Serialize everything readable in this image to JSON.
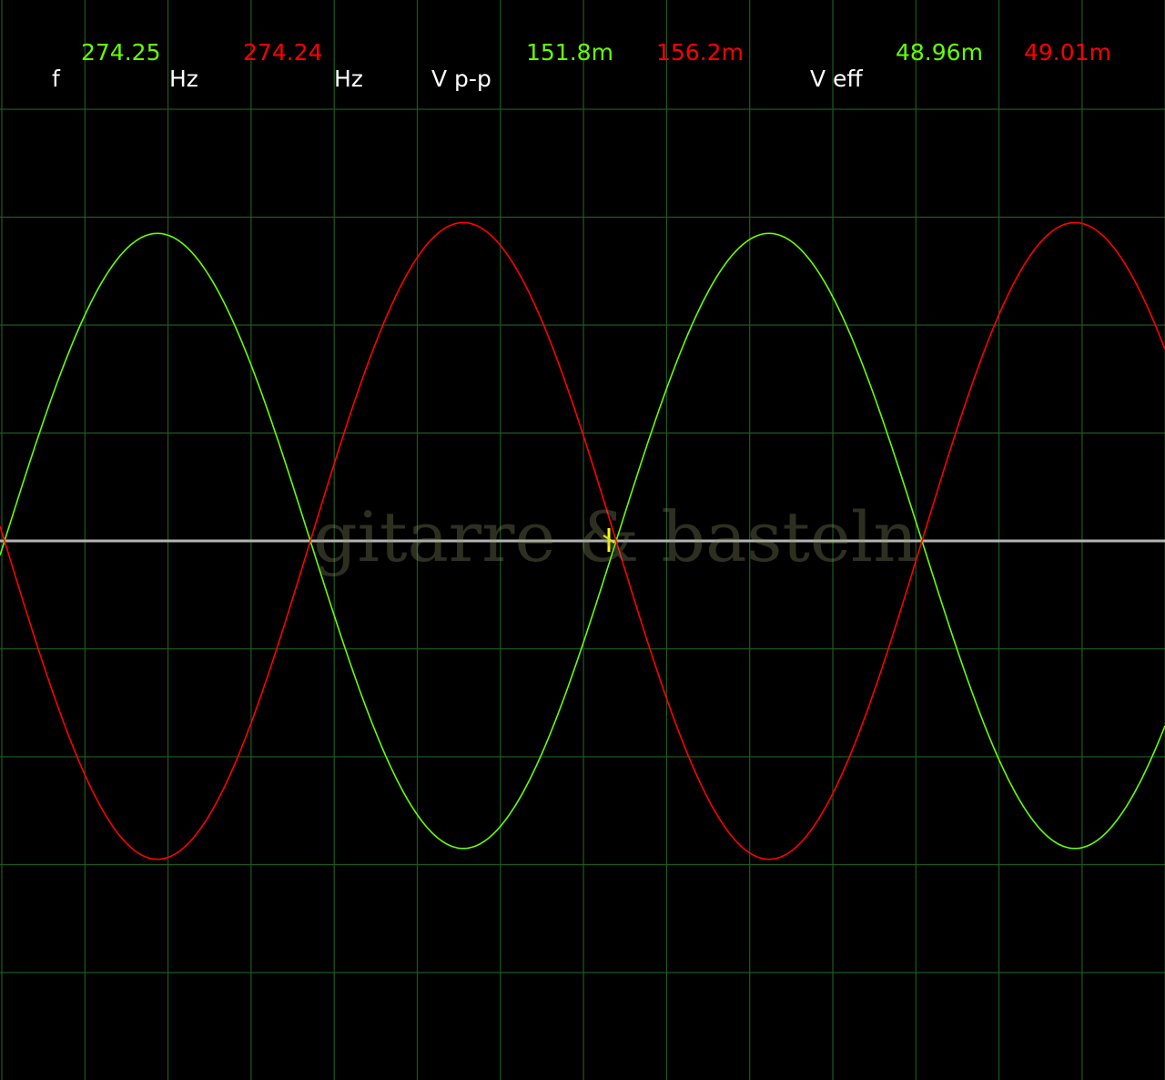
{
  "readouts": {
    "freq": {
      "label": "f",
      "ch1": "274.25",
      "ch2": "274.24",
      "unit1": "Hz",
      "unit2": "Hz"
    },
    "vpp": {
      "label": "V p-p",
      "ch1": "151.8m",
      "ch2": "156.2m"
    },
    "veff": {
      "label": "V eff",
      "ch1": "48.96m",
      "ch2": "49.01m"
    }
  },
  "watermark": "gitarre & basteln",
  "colors": {
    "background": "#000000",
    "grid": "#1e5a1e",
    "baseline": "#b4b4b4",
    "ch1": "#66ff00",
    "ch2": "#ff0000",
    "trigger": "#ffff00",
    "label": "#ffffff"
  },
  "chart_data": {
    "type": "line",
    "title": "",
    "xlabel": "",
    "ylabel": "",
    "grid": true,
    "series": [
      {
        "color": "#66ff00",
        "amplitude_divisions": 2.85,
        "cycles_on_screen": 1.9,
        "phase_deg": 0
      },
      {
        "color": "#ff0000",
        "amplitude_divisions": 2.95,
        "cycles_on_screen": 1.9,
        "phase_deg": 180
      }
    ]
  }
}
